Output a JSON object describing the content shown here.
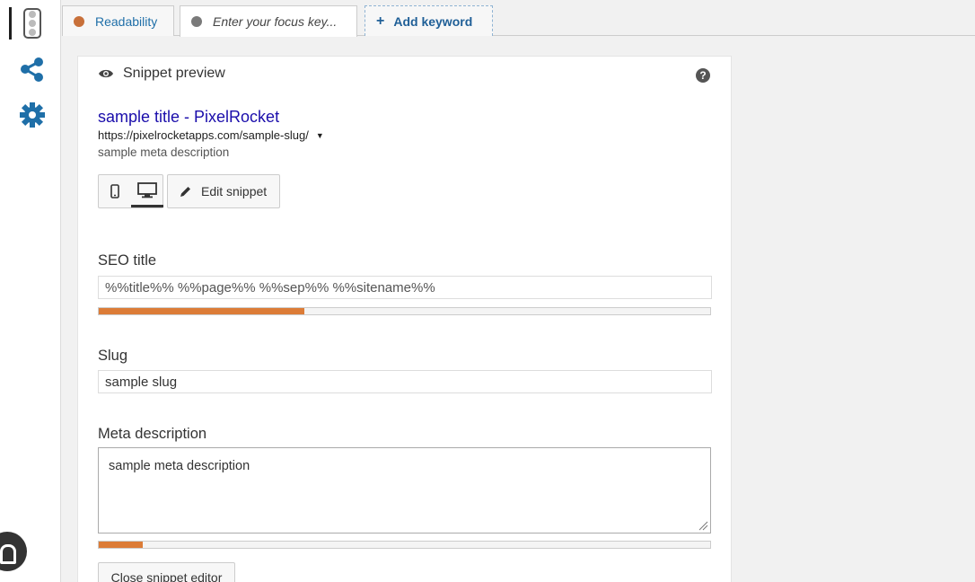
{
  "tabs": {
    "readability": {
      "label": "Readability",
      "dot_color": "#c8703a"
    },
    "focus": {
      "label": "Enter your focus key...",
      "dot_color": "#7a7a7a"
    },
    "add": {
      "label": "Add keyword",
      "icon": "plus-icon"
    }
  },
  "sidebar": {
    "items": [
      {
        "name": "traffic-light-icon"
      },
      {
        "name": "share-icon"
      },
      {
        "name": "gear-icon"
      }
    ]
  },
  "snippet": {
    "heading": "Snippet preview",
    "serp_title": "sample title - PixelRocket",
    "serp_url": "https://pixelrocketapps.com/sample-slug/",
    "serp_caret": "▼",
    "serp_description": "sample meta description",
    "edit_label": "Edit snippet",
    "help_glyph": "?"
  },
  "fields": {
    "seo_title": {
      "label": "SEO title",
      "value": "%%title%% %%page%% %%sep%% %%sitename%%",
      "progress": 0.336
    },
    "slug": {
      "label": "Slug",
      "value": "sample slug"
    },
    "meta_description": {
      "label": "Meta description",
      "value": "sample meta description",
      "progress": 0.072
    }
  },
  "close_label": "Close snippet editor",
  "colors": {
    "accent_orange": "#dc7c37",
    "link_blue": "#1a0dab",
    "icon_blue": "#1f6fa8"
  }
}
